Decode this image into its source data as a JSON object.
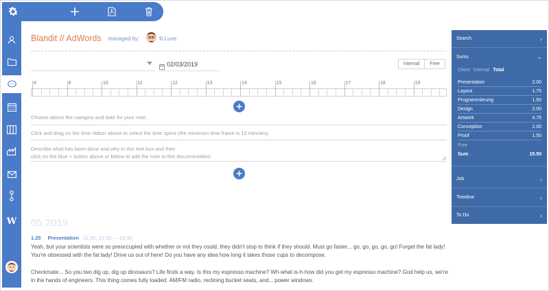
{
  "toolbar": {
    "buttons": [
      "settings-icon",
      "add-icon",
      "pdf-icon",
      "trash-icon"
    ]
  },
  "sidebar": {
    "items": [
      "user-icon",
      "folder-icon",
      "chat-icon",
      "calendar-icon",
      "columns-icon",
      "factory-icon",
      "mail-icon",
      "workflow-icon",
      "wiki-icon"
    ],
    "wiki_label": "W"
  },
  "header": {
    "title": "Blandit // AdWords",
    "managed_by": "managed by:",
    "manager": "lli Lune"
  },
  "note_form": {
    "date": "02/03/2019",
    "visibility": {
      "internal": "Internal",
      "free": "Free"
    },
    "hours": [
      "8",
      "9",
      "10",
      "11",
      "12",
      "13",
      "14",
      "15",
      "16",
      "17",
      "18",
      "19"
    ],
    "hint_category": "Choose above the category and date for your note.",
    "hint_ribbon": "Click and drag on the time ribbon above to select the time spent (the minimum time frame is 15 minutes).",
    "hint_describe_1": "Describe what has been done and why in this text box and then",
    "hint_describe_2": "click on the blue + button above or below to add the note to this documentation"
  },
  "log": {
    "month": "05.2019",
    "entry": {
      "hours": "1.25",
      "category": "Presentation",
      "time": "11.05, 12:15 — 13:30",
      "text_1": "Yeah, but your scientists were so preoccupied with whether or not they could, they didn't stop to think if they should. Must go faster... go, go, go, go, go! Forget the fat lady! You're obsessed with the fat lady! Drive us out of here! Do you have any idea how long it takes those cups to decompose.",
      "text_2": "Checkmate... So you two dig up, dig up dinosaurs? Life finds a way. Is this my espresso machine? Wh-what is-h-how did you get my espresso machine? God help us, we're in the hands of engineers. This thing comes fully loaded. AM/FM radio, reclining bucket seats, and... power windows."
    }
  },
  "right_panel": {
    "search": "Search",
    "sums": "Sums",
    "filter": {
      "client": "Client",
      "internal": "Internal",
      "total": "Total"
    },
    "rows": [
      {
        "name": "Presentation",
        "value": "2.00"
      },
      {
        "name": "Layout",
        "value": "1.75"
      },
      {
        "name": "Programmierung",
        "value": "1.50"
      },
      {
        "name": "Design",
        "value": "2.00"
      },
      {
        "name": "Artwork",
        "value": "4.75"
      },
      {
        "name": "Conception",
        "value": "2.00"
      },
      {
        "name": "Proof",
        "value": "1.50"
      }
    ],
    "free": "Free",
    "sum_label": "Sum",
    "sum_value": "15.50",
    "job": "Job",
    "timeline": "Timeline",
    "todo": "To Do",
    "chevron": "›"
  },
  "colors": {
    "accent": "#4a7bc8",
    "panel": "#3f6aa8",
    "title": "#e07b4b"
  }
}
